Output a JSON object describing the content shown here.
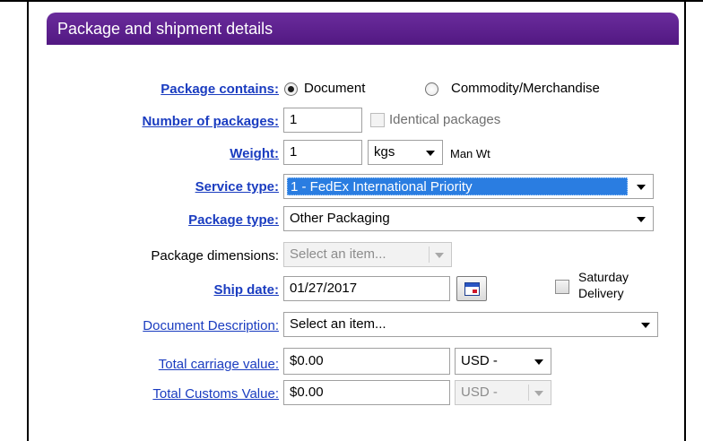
{
  "header": {
    "title": "Package and shipment details"
  },
  "package_contains": {
    "label": "Package contains:",
    "options": [
      {
        "label": "Document",
        "selected": true
      },
      {
        "label": "Commodity/Merchandise",
        "selected": false
      }
    ]
  },
  "number_of_packages": {
    "label": "Number of packages:",
    "value": "1",
    "identical_label": "Identical packages",
    "identical_checked": false
  },
  "weight": {
    "label": "Weight:",
    "value": "1",
    "unit": "kgs",
    "man_wt": "Man Wt"
  },
  "service_type": {
    "label": "Service type:",
    "value": "1 - FedEx International Priority"
  },
  "package_type": {
    "label": "Package type:",
    "value": "Other Packaging"
  },
  "package_dimensions": {
    "label": "Package dimensions:",
    "value": "Select an item..."
  },
  "ship_date": {
    "label": "Ship date:",
    "value": "01/27/2017"
  },
  "saturday_delivery": {
    "line1": "Saturday",
    "line2": "Delivery",
    "checked": false
  },
  "document_description": {
    "label": "Document Description:",
    "value": "Select an item..."
  },
  "total_carriage_value": {
    "label": "Total carriage value:",
    "value": "$0.00",
    "currency": "USD -"
  },
  "total_customs_value": {
    "label": "Total Customs Value:",
    "value": "$0.00",
    "currency": "USD -"
  },
  "colors": {
    "header_bg": "#521882",
    "link": "#1a3cc0",
    "selection": "#2a7de1"
  }
}
